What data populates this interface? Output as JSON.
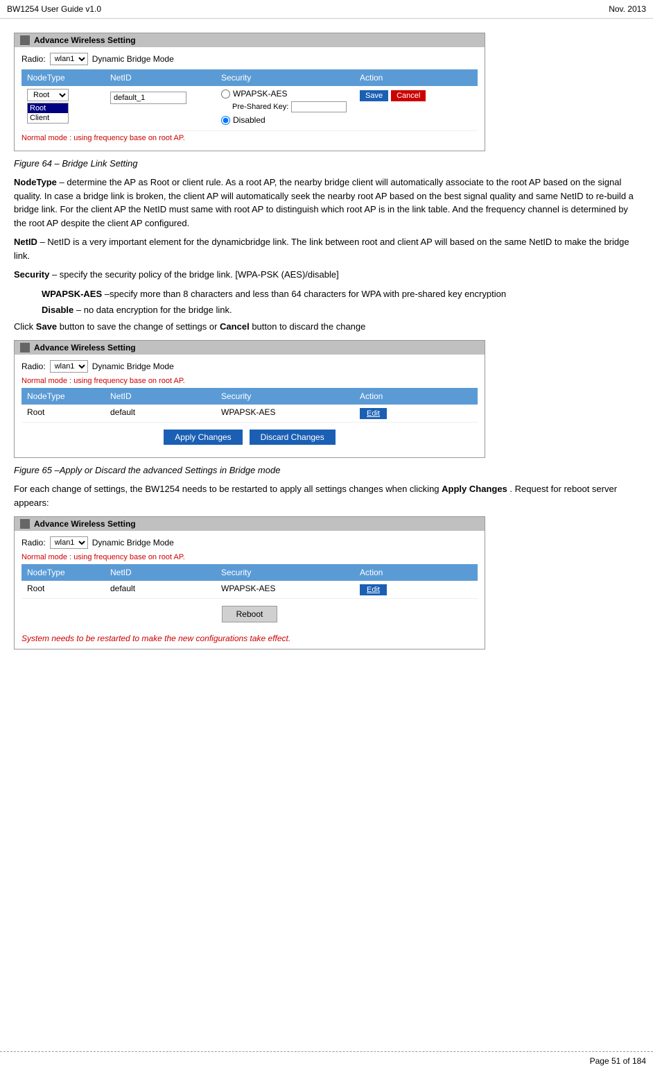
{
  "header": {
    "title": "BW1254 User Guide v1.0",
    "date": "Nov.  2013"
  },
  "box1": {
    "title": "Advance Wireless Setting",
    "radio_label": "Radio:",
    "radio_value": "wlan1",
    "mode_label": "Dynamic Bridge Mode",
    "normal_mode_text": "Normal mode : using frequency base on root AP.",
    "table_headers": [
      "NodeType",
      "NetID",
      "Security",
      "Action"
    ],
    "node_options": [
      "Root",
      "Client"
    ],
    "node_selected": "Root",
    "netid_value": "default_1",
    "security_options": [
      "WPAPSK-AES",
      "Disabled"
    ],
    "psk_label": "Pre-Shared Key:",
    "psk_value": "",
    "btn_save": "Save",
    "btn_cancel": "Cancel"
  },
  "figure1_caption": "Figure 64 – Bridge Link Setting",
  "para_nodetype": "NodeType – determine the AP as Root or client rule. As a root AP, the nearby bridge client will automatically associate to the root AP based on the signal quality. In case a bridge link is broken, the client AP will automatically seek the nearby root AP based on the best signal quality and same NetID to re-build a bridge link. For the client AP the NetID must same with root AP to distinguish which root AP is in the link table. And the frequency channel is determined by the root AP despite the client AP configured.",
  "para_netid": "NetID – NetID is a very important element for the dynamicbridge link. The link between root and client AP will based on the same NetID to make the bridge link.",
  "para_security": "Security – specify the security policy of the bridge link. [WPA-PSK (AES)/disable]",
  "para_wpapsk": "WPAPSK-AES –specify more than 8 characters and less than 64 characters for WPA with pre-shared key encryption",
  "para_disable": "Disable – no data encryption for the bridge link.",
  "para_save": "Click Save button to save the change of settings or Cancel button to discard the change",
  "box2": {
    "title": "Advance Wireless Setting",
    "radio_label": "Radio:",
    "radio_value": "wlan1",
    "mode_label": "Dynamic Bridge Mode",
    "normal_mode_text": "Normal mode : using frequency base on root AP.",
    "table_headers": [
      "NodeType",
      "NetID",
      "Security",
      "Action"
    ],
    "row": {
      "node": "Root",
      "netid": "default",
      "security": "WPAPSK-AES",
      "action": "Edit"
    },
    "btn_apply": "Apply Changes",
    "btn_discard": "Discard Changes"
  },
  "figure2_caption": "Figure 65 –Apply or Discard the advanced Settings in Bridge mode",
  "para_apply": "For each change of settings, the BW1254 needs to be restarted to apply all settings changes when clicking Apply Changes. Request for reboot server appears:",
  "box3": {
    "title": "Advance Wireless Setting",
    "radio_label": "Radio:",
    "radio_value": "wlan1",
    "mode_label": "Dynamic Bridge Mode",
    "normal_mode_text": "Normal mode : using frequency base on root AP.",
    "table_headers": [
      "NodeType",
      "NetID",
      "Security",
      "Action"
    ],
    "row": {
      "node": "Root",
      "netid": "default",
      "security": "WPAPSK-AES",
      "action": "Edit"
    },
    "btn_reboot": "Reboot",
    "warning_text": "System needs to be restarted to make the new configurations take effect."
  },
  "footer": {
    "page_text": "Page 51 of 184"
  }
}
